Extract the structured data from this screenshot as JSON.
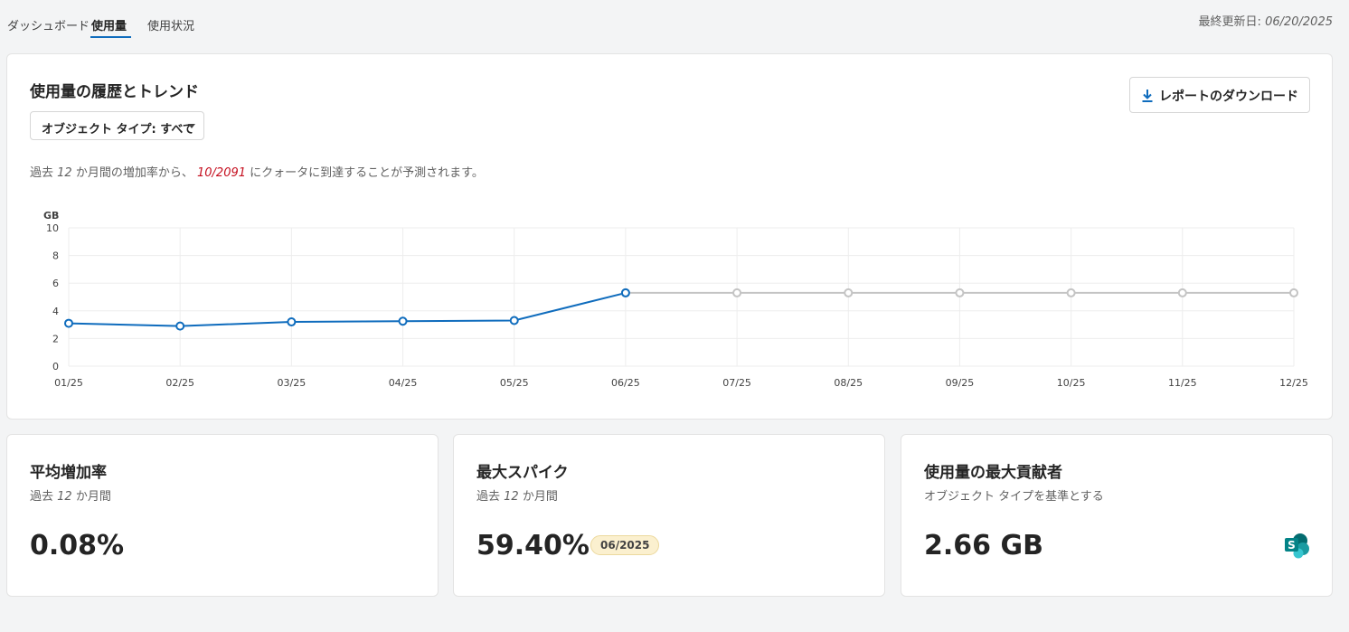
{
  "tabs": [
    {
      "label": "ダッシュボード",
      "active": false
    },
    {
      "label": "使用量",
      "active": true
    },
    {
      "label": "使用状況",
      "active": false
    }
  ],
  "last_updated": {
    "label": "最終更新日:",
    "date": "06/20/2025"
  },
  "history": {
    "title": "使用量の履歴とトレンド",
    "filter_label": "オブジェクト タイプ: すべて",
    "download_label": "レポートのダウンロード",
    "forecast": {
      "pre": "過去",
      "months": "12",
      "mid": "か月間の増加率から、",
      "date": "10/2091",
      "post": "にクォータに到達することが予測されます。"
    }
  },
  "chart_data": {
    "type": "line",
    "ylabel": "GB",
    "ylim": [
      0,
      10
    ],
    "yticks": [
      0,
      2,
      4,
      6,
      8,
      10
    ],
    "categories": [
      "01/25",
      "02/25",
      "03/25",
      "04/25",
      "05/25",
      "06/25",
      "07/25",
      "08/25",
      "09/25",
      "10/25",
      "11/25",
      "12/25"
    ],
    "series": [
      {
        "values": [
          3.1,
          2.9,
          3.2,
          3.25,
          3.3,
          5.3,
          null,
          null,
          null,
          null,
          null,
          null
        ],
        "color": "#0f6cbd"
      },
      {
        "values": [
          null,
          null,
          null,
          null,
          null,
          5.3,
          5.3,
          5.3,
          5.3,
          5.3,
          5.3,
          5.3
        ],
        "color": "#c4c4c4"
      }
    ],
    "grid": true
  },
  "cards": [
    {
      "title": "平均増加率",
      "sub_pre": "過去",
      "sub_num": "12",
      "sub_post": "か月間",
      "value": "0.08%"
    },
    {
      "title": "最大スパイク",
      "sub_pre": "過去",
      "sub_num": "12",
      "sub_post": "か月間",
      "value": "59.40%",
      "badge": "06/2025"
    },
    {
      "title": "使用量の最大貢献者",
      "subtitle": "オブジェクト タイプを基準とする",
      "value": "2.66 GB",
      "icon": "sharepoint-icon"
    }
  ],
  "colors": {
    "accent": "#0f6cbd",
    "forecast": "#c50f1f",
    "badge_bg": "#fbf0cf",
    "sharepoint": "#038387"
  }
}
